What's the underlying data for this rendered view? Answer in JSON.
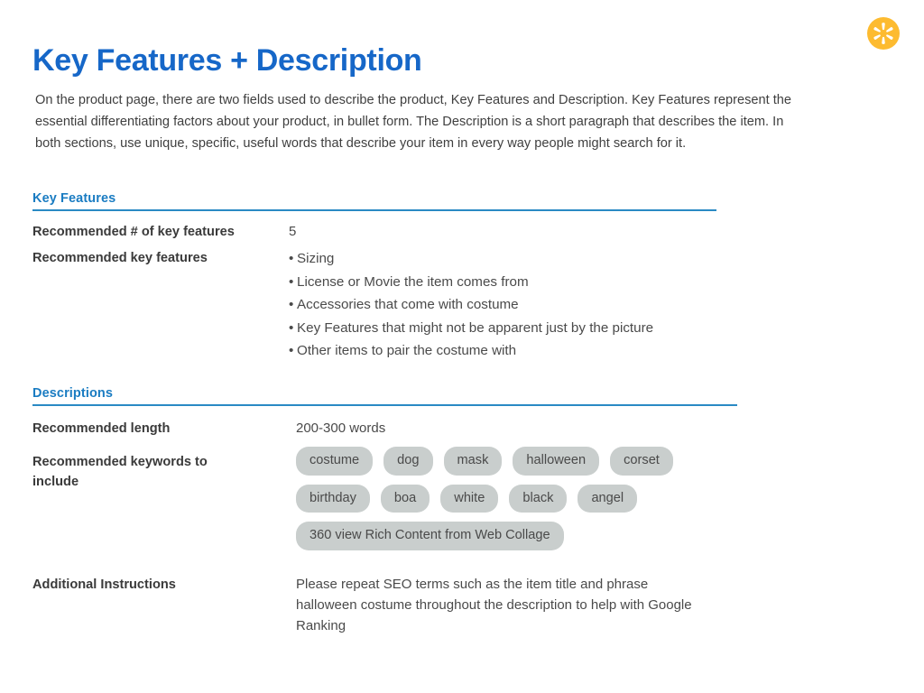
{
  "brand": {
    "logo_icon": "walmart-spark-icon",
    "logo_color": "#fdbb30",
    "ray_color": "#ffffff"
  },
  "colors": {
    "title_blue": "#1667c8",
    "section_blue": "#1a7cc2",
    "rule_blue": "#2a8ac4",
    "pill_background": "#c9cecd",
    "body_text": "#404040"
  },
  "header": {
    "title": "Key Features + Description",
    "intro": "On the product page, there are two fields used to describe the product, Key Features and Description. Key Features represent the essential differentiating factors about your product, in bullet form. The Description is a short paragraph that describes the item. In both sections, use unique, specific,  useful words that describe your item in every way people might search for it."
  },
  "key_features": {
    "heading": "Key Features",
    "recommended_count_label": "Recommended # of key features",
    "recommended_count_value": "5",
    "recommended_features_label": "Recommended key features",
    "features": [
      "Sizing",
      "License or Movie the item comes from",
      "Accessories that come with costume",
      "Key Features that might not be apparent just by the picture",
      "Other items to pair the costume with"
    ]
  },
  "descriptions": {
    "heading": "Descriptions",
    "length_label": "Recommended length",
    "length_value": "200-300 words",
    "keywords_label": "Recommended keywords to include",
    "keyword_rows": [
      [
        "costume",
        "dog",
        "mask",
        "halloween",
        "corset"
      ],
      [
        "birthday",
        "boa",
        "white",
        "black",
        "angel"
      ],
      [
        "360 view Rich Content from Web Collage"
      ]
    ],
    "instructions_label": "Additional Instructions",
    "instructions_value": "Please repeat SEO terms such as the item title and phrase halloween costume throughout the description to help with Google Ranking"
  }
}
